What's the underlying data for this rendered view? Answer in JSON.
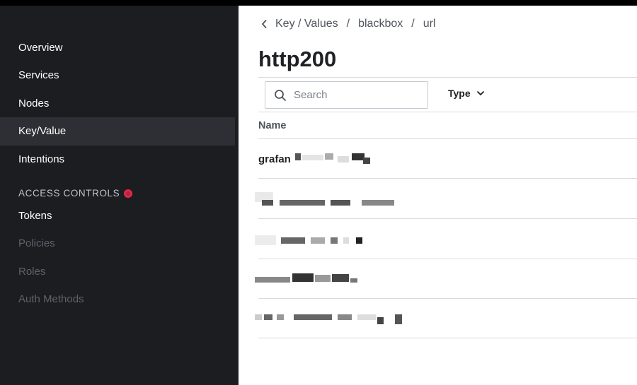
{
  "sidebar": {
    "items": [
      {
        "label": "Overview"
      },
      {
        "label": "Services"
      },
      {
        "label": "Nodes"
      },
      {
        "label": "Key/Value"
      },
      {
        "label": "Intentions"
      }
    ],
    "access_heading": "ACCESS CONTROLS",
    "access_items": [
      {
        "label": "Tokens"
      },
      {
        "label": "Policies"
      },
      {
        "label": "Roles"
      },
      {
        "label": "Auth Methods"
      }
    ]
  },
  "breadcrumb": {
    "items": [
      "Key / Values",
      "blackbox",
      "url"
    ],
    "separator": "/"
  },
  "page": {
    "title": "http200"
  },
  "toolbar": {
    "search_placeholder": "Search",
    "type_label": "Type"
  },
  "table": {
    "name_header": "Name",
    "rows": [
      {
        "name": "grafan"
      },
      {
        "name": ""
      },
      {
        "name": ""
      },
      {
        "name": ""
      },
      {
        "name": ""
      }
    ]
  },
  "colors": {
    "sidebar_bg": "#1b1d21",
    "active_item_bg": "#2d2f35",
    "alert_dot": "#e2274c",
    "text_dark": "#1f2124"
  },
  "icons": {
    "back": "chevron-left-icon",
    "search": "search-icon",
    "type_dropdown": "chevron-down-icon",
    "access_alert": "alert-dot-icon"
  }
}
